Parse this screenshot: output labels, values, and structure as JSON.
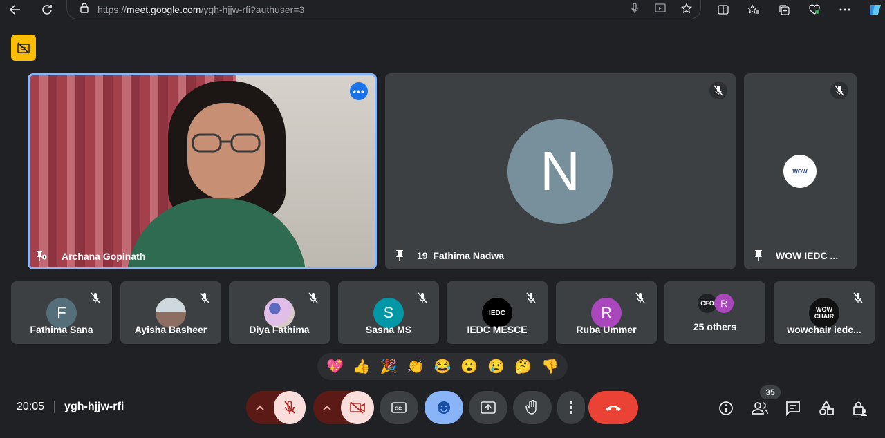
{
  "browser": {
    "url_prefix": "https://",
    "url_host": "meet.google.com",
    "url_path": "/ygh-hjjw-rfi?authuser=3",
    "icons": [
      "back-icon",
      "refresh-icon",
      "lock-icon",
      "mic-icon",
      "cast-icon",
      "star-icon",
      "split-screen-icon",
      "favorites-icon",
      "collections-icon",
      "health-icon",
      "more-icon",
      "copilot-icon"
    ]
  },
  "tiles": {
    "main": {
      "name": "Archana Gopinath"
    },
    "second": {
      "name": "19_Fathima Nadwa",
      "initial": "N",
      "avatar_color": "#78909c"
    },
    "third": {
      "name": "WOW IEDC ...",
      "logo_text": "WOW"
    }
  },
  "participants": [
    {
      "name": "Fathima Sana",
      "initial": "F",
      "color": "#546e7a"
    },
    {
      "name": "Ayisha Basheer",
      "initial": "",
      "color": "#8d8d8d"
    },
    {
      "name": "Diya Fathima",
      "initial": "",
      "color": "#c9a6a6"
    },
    {
      "name": "Sasna MS",
      "initial": "S",
      "color": "#0097a7"
    },
    {
      "name": "IEDC MESCE",
      "initial": "IEDC",
      "color": "#000000"
    },
    {
      "name": "Ruba Ummer",
      "initial": "R",
      "color": "#ab47bc"
    },
    {
      "name": "25 others",
      "initial": "CEO",
      "initial2": "R",
      "color": "#202124",
      "color2": "#ab47bc"
    },
    {
      "name": "wowchair iedc...",
      "initial": "WOW CHAIR",
      "color": "#111111"
    }
  ],
  "reactions": [
    "💖",
    "👍",
    "🎉",
    "👏",
    "😂",
    "😮",
    "😢",
    "🤔",
    "👎"
  ],
  "meeting": {
    "time": "20:05",
    "code": "ygh-hjjw-rfi",
    "participant_count": "35"
  },
  "colors": {
    "accent": "#8ab4f8",
    "end_call": "#ea4335",
    "mic_off_bg": "#f9dedc",
    "badge": "#fbbc04"
  }
}
